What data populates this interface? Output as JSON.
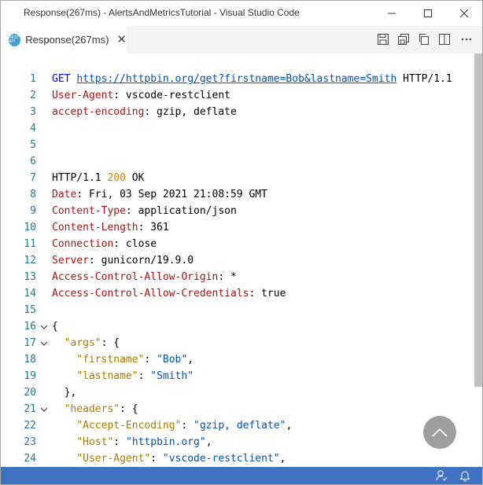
{
  "window": {
    "title": "Response(267ms) - AlertsAndMetricsTutorial - Visual Studio Code"
  },
  "tab": {
    "label": "Response(267ms)",
    "icon_text": "REST API",
    "close_glyph": "✕"
  },
  "colors": {
    "status_bar": "#3f72c0",
    "line_number": "#237893",
    "keyword_red": "#a31515",
    "string_blue": "#0451a5",
    "json_key_gold": "#a67c00"
  },
  "editor": {
    "lines": [
      {
        "n": "1",
        "tokens": [
          [
            "m",
            "GET "
          ],
          [
            "url",
            "https://httpbin.org/get?firstname=Bob&lastname=Smith"
          ],
          [
            "plain",
            " HTTP/1.1"
          ]
        ]
      },
      {
        "n": "2",
        "tokens": [
          [
            "k",
            "User-Agent"
          ],
          [
            "plain",
            ": vscode-restclient"
          ]
        ]
      },
      {
        "n": "3",
        "tokens": [
          [
            "k",
            "accept-encoding"
          ],
          [
            "plain",
            ": gzip, deflate"
          ]
        ]
      },
      {
        "n": "4",
        "tokens": []
      },
      {
        "n": "5",
        "tokens": []
      },
      {
        "n": "6",
        "tokens": []
      },
      {
        "n": "7",
        "tokens": [
          [
            "plain",
            "HTTP/1.1 "
          ],
          [
            "o",
            "200"
          ],
          [
            "plain",
            " OK"
          ]
        ]
      },
      {
        "n": "8",
        "tokens": [
          [
            "k",
            "Date"
          ],
          [
            "plain",
            ": Fri, 03 Sep 2021 21:08:59 GMT"
          ]
        ]
      },
      {
        "n": "9",
        "tokens": [
          [
            "k",
            "Content-Type"
          ],
          [
            "plain",
            ": application/json"
          ]
        ]
      },
      {
        "n": "10",
        "tokens": [
          [
            "k",
            "Content-Length"
          ],
          [
            "plain",
            ": 361"
          ]
        ]
      },
      {
        "n": "11",
        "tokens": [
          [
            "k",
            "Connection"
          ],
          [
            "plain",
            ": close"
          ]
        ]
      },
      {
        "n": "12",
        "tokens": [
          [
            "k",
            "Server"
          ],
          [
            "plain",
            ": gunicorn/19.9.0"
          ]
        ]
      },
      {
        "n": "13",
        "tokens": [
          [
            "k",
            "Access-Control-Allow-Origin"
          ],
          [
            "plain",
            ": *"
          ]
        ]
      },
      {
        "n": "14",
        "tokens": [
          [
            "k",
            "Access-Control-Allow-Credentials"
          ],
          [
            "plain",
            ": true"
          ]
        ]
      },
      {
        "n": "15",
        "tokens": []
      },
      {
        "n": "16",
        "fold": true,
        "tokens": [
          [
            "plain",
            "{"
          ]
        ]
      },
      {
        "n": "17",
        "fold": true,
        "tokens": [
          [
            "plain",
            "  "
          ],
          [
            "jk",
            "\"args\""
          ],
          [
            "plain",
            ": {"
          ]
        ]
      },
      {
        "n": "18",
        "tokens": [
          [
            "plain",
            "    "
          ],
          [
            "jk",
            "\"firstname\""
          ],
          [
            "plain",
            ": "
          ],
          [
            "str",
            "\"Bob\""
          ],
          [
            "plain",
            ","
          ]
        ]
      },
      {
        "n": "19",
        "tokens": [
          [
            "plain",
            "    "
          ],
          [
            "jk",
            "\"lastname\""
          ],
          [
            "plain",
            ": "
          ],
          [
            "str",
            "\"Smith\""
          ]
        ]
      },
      {
        "n": "20",
        "tokens": [
          [
            "plain",
            "  },"
          ]
        ]
      },
      {
        "n": "21",
        "fold": true,
        "tokens": [
          [
            "plain",
            "  "
          ],
          [
            "jk",
            "\"headers\""
          ],
          [
            "plain",
            ": {"
          ]
        ]
      },
      {
        "n": "22",
        "tokens": [
          [
            "plain",
            "    "
          ],
          [
            "jk",
            "\"Accept-Encoding\""
          ],
          [
            "plain",
            ": "
          ],
          [
            "str",
            "\"gzip, deflate\""
          ],
          [
            "plain",
            ","
          ]
        ]
      },
      {
        "n": "23",
        "tokens": [
          [
            "plain",
            "    "
          ],
          [
            "jk",
            "\"Host\""
          ],
          [
            "plain",
            ": "
          ],
          [
            "str",
            "\"httpbin.org\""
          ],
          [
            "plain",
            ","
          ]
        ]
      },
      {
        "n": "24",
        "tokens": [
          [
            "plain",
            "    "
          ],
          [
            "jk",
            "\"User-Agent\""
          ],
          [
            "plain",
            ": "
          ],
          [
            "str",
            "\"vscode-restclient\""
          ],
          [
            "plain",
            ","
          ]
        ]
      }
    ]
  }
}
